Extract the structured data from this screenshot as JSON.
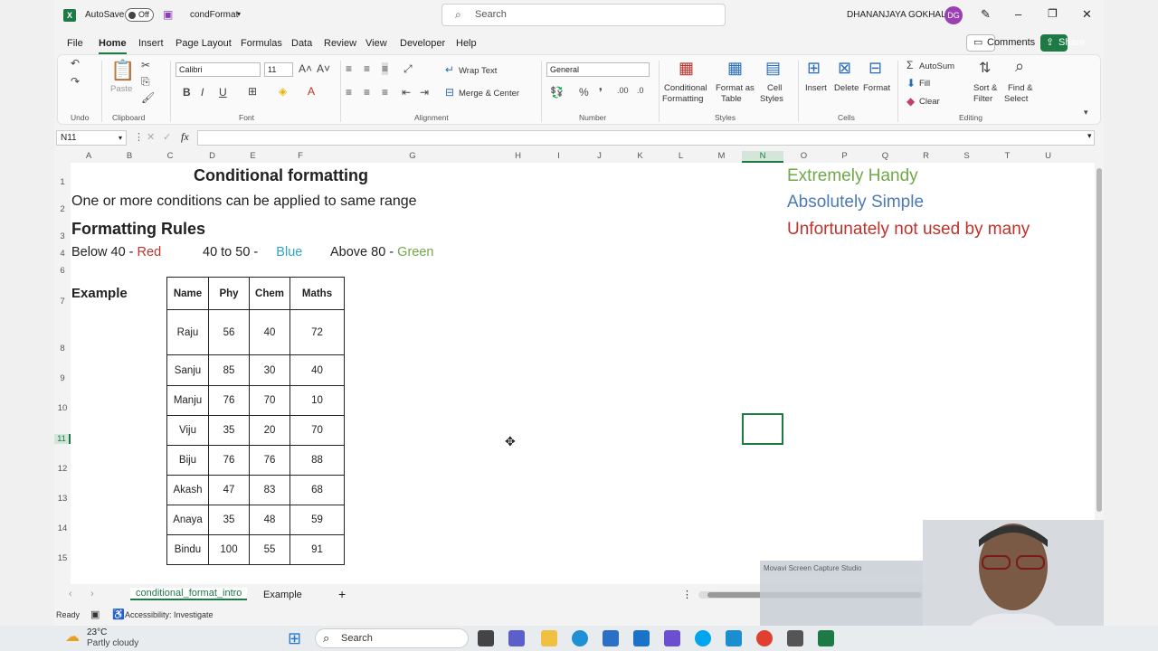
{
  "titlebar": {
    "autosave_label": "AutoSave",
    "autosave_state": "Off",
    "filename": "condFormat",
    "search_placeholder": "Search",
    "user_name": "DHANANJAYA GOKHALE",
    "user_initials": "DG"
  },
  "menu": {
    "items": [
      "File",
      "Home",
      "Insert",
      "Page Layout",
      "Formulas",
      "Data",
      "Review",
      "View",
      "Developer",
      "Help"
    ],
    "active": "Home",
    "comments": "Comments",
    "share": "Share"
  },
  "ribbon": {
    "undo_label": "Undo",
    "clipboard": {
      "label": "Clipboard",
      "paste": "Paste"
    },
    "font": {
      "label": "Font",
      "name": "Calibri",
      "size": "11"
    },
    "alignment": {
      "label": "Alignment",
      "wrap_text": "Wrap Text",
      "merge_center": "Merge & Center"
    },
    "number": {
      "label": "Number",
      "format": "General"
    },
    "styles": {
      "label": "Styles",
      "conditional_formatting": [
        "Conditional",
        "Formatting"
      ],
      "format_as_table": [
        "Format as",
        "Table"
      ],
      "cell_styles": [
        "Cell",
        "Styles"
      ]
    },
    "cells": {
      "label": "Cells",
      "insert": "Insert",
      "delete": "Delete",
      "format": "Format"
    },
    "editing": {
      "label": "Editing",
      "autosum": "AutoSum",
      "fill": "Fill",
      "clear": "Clear",
      "sort_filter": [
        "Sort &",
        "Filter"
      ],
      "find_select": [
        "Find &",
        "Select"
      ]
    }
  },
  "formula_bar": {
    "name_box": "N11",
    "fx": "fx",
    "content": ""
  },
  "columns": [
    "A",
    "B",
    "C",
    "D",
    "E",
    "F",
    "G",
    "H",
    "I",
    "J",
    "K",
    "L",
    "M",
    "N",
    "O",
    "P",
    "Q",
    "R",
    "S",
    "T",
    "U"
  ],
  "rows": [
    "1",
    "2",
    "3",
    "4",
    "6",
    "7",
    "8",
    "9",
    "10",
    "11",
    "12",
    "13",
    "14",
    "15"
  ],
  "sheet": {
    "title": "Conditional formatting",
    "subtitle": "One or more conditions can be applied to same range",
    "rules_heading": "Formatting Rules",
    "rule_below_prefix": "Below 40 - ",
    "rule_below_color_word": "Red",
    "rule_mid_prefix": "40 to 50 - ",
    "rule_mid_color_word": "Blue",
    "rule_above_prefix": "Above 80 - ",
    "rule_above_color_word": "Green",
    "example_label": "Example",
    "note1": "Extremely Handy",
    "note2": "Absolutely Simple",
    "note3": "Unfortunately not used by many",
    "table_headers": [
      "Name",
      "Phy",
      "Chem",
      "Maths"
    ],
    "table_rows": [
      [
        "Raju",
        "56",
        "40",
        "72"
      ],
      [
        "Sanju",
        "85",
        "30",
        "40"
      ],
      [
        "Manju",
        "76",
        "70",
        "10"
      ],
      [
        "Viju",
        "35",
        "20",
        "70"
      ],
      [
        "Biju",
        "76",
        "76",
        "88"
      ],
      [
        "Akash",
        "47",
        "83",
        "68"
      ],
      [
        "Anaya",
        "35",
        "48",
        "59"
      ],
      [
        "Bindu",
        "100",
        "55",
        "91"
      ]
    ]
  },
  "colors": {
    "red": "#c0322b",
    "blue": "#2fa3c8",
    "green": "#70a84a",
    "note_blue": "#4a7ab5",
    "excel_green": "#1d7a45"
  },
  "sheet_tabs": [
    "conditional_format_intro",
    "Example"
  ],
  "active_sheet_tab": "conditional_format_intro",
  "status": {
    "ready": "Ready",
    "accessibility": "Accessibility: Investigate"
  },
  "taskbar": {
    "weather_temp": "23°C",
    "weather_desc": "Partly cloudy",
    "search": "Search"
  },
  "recording_overlay": {
    "title": "Movavi Screen Capture Studio"
  }
}
